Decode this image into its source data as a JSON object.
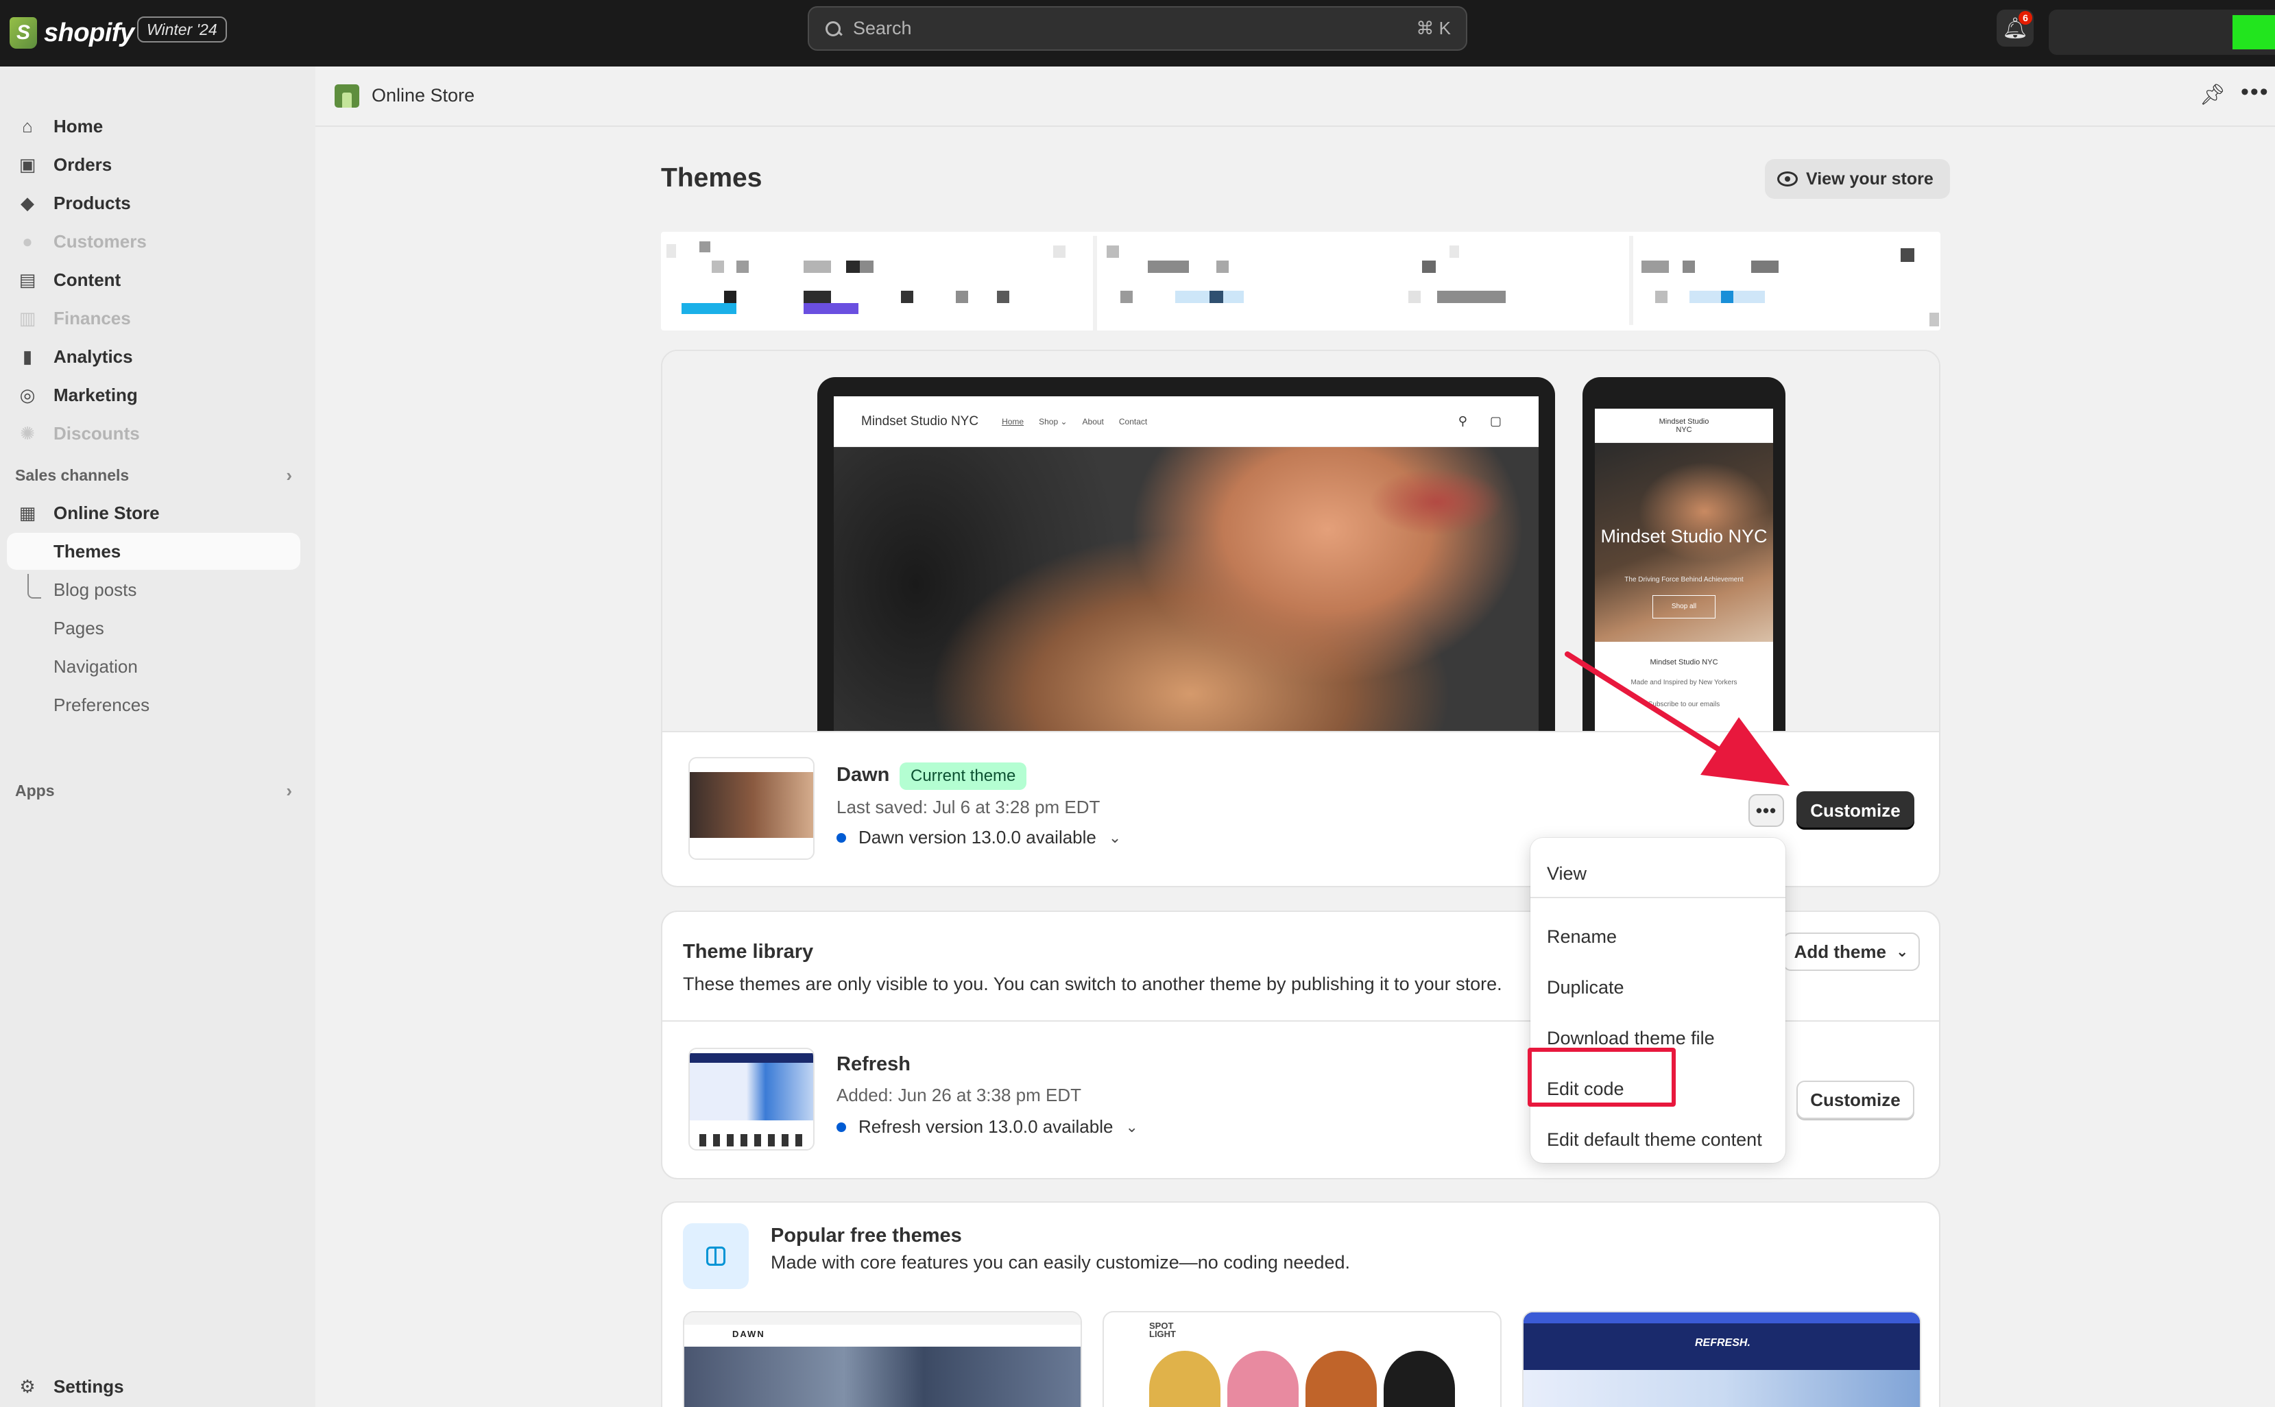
{
  "topbar": {
    "logo_text": "shopify",
    "edition_badge": "Winter '24",
    "search_placeholder": "Search",
    "search_shortcut": "⌘ K",
    "notification_count": "6",
    "colors": {
      "bg": "#1a1a1a",
      "account_swatch": "#22e51e"
    }
  },
  "sidebar": {
    "items": [
      {
        "label": "Home",
        "icon": "home-icon",
        "disabled": false
      },
      {
        "label": "Orders",
        "icon": "inbox-icon",
        "disabled": false
      },
      {
        "label": "Products",
        "icon": "tag-icon",
        "disabled": false
      },
      {
        "label": "Customers",
        "icon": "person-icon",
        "disabled": true
      },
      {
        "label": "Content",
        "icon": "image-icon",
        "disabled": false
      },
      {
        "label": "Finances",
        "icon": "bank-icon",
        "disabled": true
      },
      {
        "label": "Analytics",
        "icon": "bar-chart-icon",
        "disabled": false
      },
      {
        "label": "Marketing",
        "icon": "target-icon",
        "disabled": false
      },
      {
        "label": "Discounts",
        "icon": "discount-icon",
        "disabled": true
      }
    ],
    "sales_channels_label": "Sales channels",
    "online_store_label": "Online Store",
    "sub_items": [
      "Themes",
      "Blog posts",
      "Pages",
      "Navigation",
      "Preferences"
    ],
    "apps_label": "Apps",
    "settings_label": "Settings"
  },
  "header": {
    "title": "Online Store"
  },
  "main": {
    "page_title": "Themes",
    "view_store_label": "View your store",
    "preview": {
      "desktop_brand": "Mindset Studio NYC",
      "desktop_links": [
        "Home",
        "Shop ⌄",
        "About",
        "Contact"
      ],
      "phone_brand": "Mindset Studio NYC",
      "phone_hero_title": "Mindset Studio NYC",
      "phone_hero_sub": "The Driving Force Behind Achievement",
      "phone_hero_button": "Shop all",
      "phone_footer_title": "Mindset Studio NYC",
      "phone_footer_sub": "Made and Inspired by New Yorkers",
      "phone_footer_sub2": "Subscribe to our emails"
    },
    "current_theme": {
      "name": "Dawn",
      "badge": "Current theme",
      "last_saved": "Last saved: Jul 6 at 3:28 pm EDT",
      "version": "Dawn version 13.0.0 available",
      "customize_label": "Customize",
      "more_label": "•••"
    },
    "library": {
      "title": "Theme library",
      "description": "These themes are only visible to you. You can switch to another theme by publishing it to your store.",
      "add_theme_label": "Add theme",
      "theme": {
        "name": "Refresh",
        "added": "Added: Jun 26 at 3:38 pm EDT",
        "version": "Refresh version 13.0.0 available",
        "customize_label": "Customize"
      }
    },
    "popular": {
      "title": "Popular free themes",
      "description": "Made with core features you can easily customize—no coding needed.",
      "themes": [
        "DAWN",
        "SPOT LIGHT",
        "REFRESH."
      ]
    }
  },
  "menu": {
    "items": [
      "View",
      "Rename",
      "Duplicate",
      "Download theme file",
      "Edit code",
      "Edit default theme content"
    ],
    "highlighted": "Edit code",
    "highlight_color": "#e8183d"
  }
}
